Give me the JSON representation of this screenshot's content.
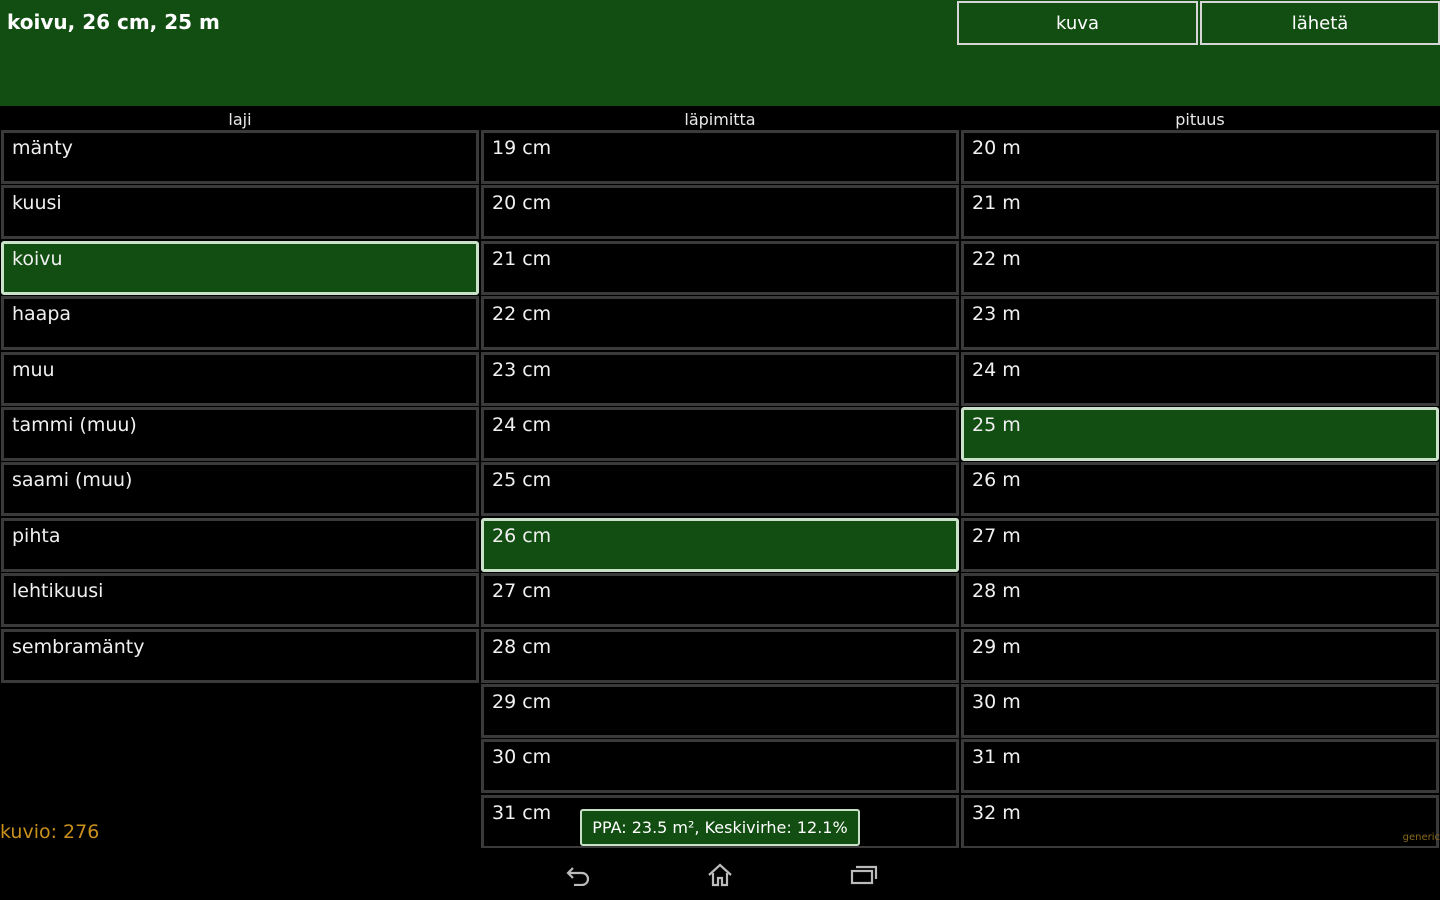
{
  "header": {
    "title": "koivu, 26 cm, 25 m",
    "kuva_label": "kuva",
    "laheta_label": "lähetä"
  },
  "columns": {
    "laji_header": "laji",
    "lapimitta_header": "läpimitta",
    "pituus_header": "pituus"
  },
  "laji": {
    "selected_index": 2,
    "items": [
      "mänty",
      "kuusi",
      "koivu",
      "haapa",
      "muu",
      "tammi (muu)",
      "saami (muu)",
      "pihta",
      "lehtikuusi",
      "sembramänty"
    ]
  },
  "lapimitta": {
    "selected_index": 7,
    "items": [
      "19 cm",
      "20 cm",
      "21 cm",
      "22 cm",
      "23 cm",
      "24 cm",
      "25 cm",
      "26 cm",
      "27 cm",
      "28 cm",
      "29 cm",
      "30 cm",
      "31 cm"
    ]
  },
  "pituus": {
    "selected_index": 5,
    "items": [
      "20 m",
      "21 m",
      "22 m",
      "23 m",
      "24 m",
      "25 m",
      "26 m",
      "27 m",
      "28 m",
      "29 m",
      "30 m",
      "31 m",
      "32 m"
    ]
  },
  "footer": {
    "kuvio": "kuvio: 276",
    "ppa": "PPA: 23.5 m², Keskivirhe:  12.1%",
    "generic": "generic"
  },
  "navbar": {
    "back_icon": "back-icon",
    "home_icon": "home-icon",
    "recent_icon": "recent-apps-icon"
  },
  "colors": {
    "accent_green": "#124d12",
    "selected_border": "#c9e0c9",
    "cell_border": "#3a3a3a",
    "kuvio_text": "#c9901c"
  }
}
